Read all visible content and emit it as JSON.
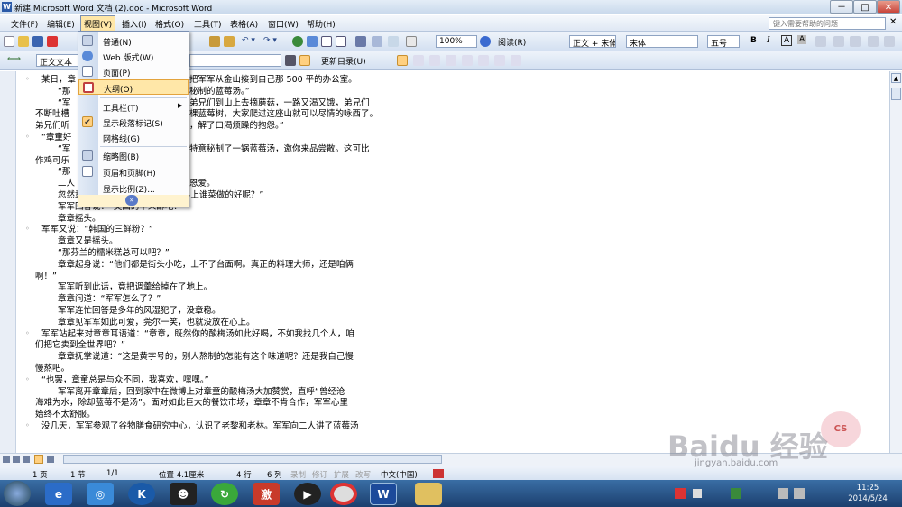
{
  "window": {
    "title": "新建 Microsoft Word 文档 (2).doc - Microsoft Word",
    "controls": [
      "－",
      "□",
      "✕"
    ]
  },
  "menubar": {
    "items": [
      "文件(F)",
      "编辑(E)",
      "视图(V)",
      "插入(I)",
      "格式(O)",
      "工具(T)",
      "表格(A)",
      "窗口(W)",
      "帮助(H)"
    ],
    "help_placeholder": "键入需要帮助的问题"
  },
  "toolbar1": {
    "zoom": "100%",
    "read_mode": "阅读(R)",
    "style": "正文 + 宋体",
    "font": "宋体",
    "size": "五号",
    "bold": "B",
    "italic": "I",
    "charborder": "A",
    "charshade": "A"
  },
  "toolbar2": {
    "style_box": "正文文本",
    "update_toc": "更新目录(U)"
  },
  "view_menu": {
    "items": [
      {
        "label": "普通(N)"
      },
      {
        "label": "Web 版式(W)"
      },
      {
        "label": "页面(P)"
      },
      {
        "label": "大纲(O)",
        "highlighted": true
      },
      {
        "label": "工具栏(T)",
        "submenu": true
      },
      {
        "label": "显示段落标记(S)",
        "checked": true
      },
      {
        "label": "网格线(G)"
      },
      {
        "label": "缩略图(B)"
      },
      {
        "label": "页眉和页脚(H)"
      },
      {
        "label": "显示比例(Z)..."
      }
    ],
    "expand": "»"
  },
  "document": {
    "lines": [
      {
        "text": "某日，章",
        "tail": "把军军从金山接到自己那 500 平的办公室。"
      },
      {
        "text": "“那",
        "tail": "秘制的蓝莓汤。”"
      },
      {
        "text": "“军",
        "tail": "弟兄们到山上去摘蘑菇，一路又渴又饿，弟兄们"
      },
      {
        "text": "不断吐槽",
        "tail": "棵蓝莓树，大家爬过这座山就可以尽情的咏西了。"
      },
      {
        "text": "弟兄们听",
        "tail": "，解了口渴烦躁的抱怨。”"
      },
      {
        "text": "“章童好",
        "tail": ""
      },
      {
        "text": "“军",
        "tail": "特意秘制了一锅蓝莓汤，邀你来品尝散。这可比"
      },
      {
        "text": "作鸡可乐",
        "tail": ""
      },
      {
        "text": "“那",
        "tail": ""
      },
      {
        "text": "二人",
        "tail": "恩爱。"
      },
      {
        "text": "忽然章章开口问军军：“你觉得世界上谁菜做的好呢？”",
        "tail": ""
      },
      {
        "text": "军军回答说：“美国的苹果酥吧？”",
        "tail": ""
      },
      {
        "text": "章章摇头。",
        "tail": ""
      },
      {
        "text": "军军又说：“韩国的三鲜粉？”",
        "tail": ""
      },
      {
        "text": "章章又是摇头。",
        "tail": ""
      },
      {
        "text": "“那芬兰的糯米糕总可以吧？”",
        "tail": ""
      },
      {
        "text": "章章起身说：“他们都是街头小吃，上不了台面啊。真正的料理大师，还是咱俩",
        "tail": ""
      },
      {
        "text": "啊！”",
        "tail": ""
      },
      {
        "text": "军军听到此话，竟把调羹给掉在了地上。",
        "tail": ""
      },
      {
        "text": "章章问道：“军军怎么了？”",
        "tail": ""
      },
      {
        "text": "军军连忙回答是多年的风湿犯了，没章稳。",
        "tail": ""
      },
      {
        "text": "章章见军军如此可爱，莞尔一笑，也就没放在心上。",
        "tail": ""
      },
      {
        "text": "军军站起来对章章耳语道：“章章，既然你的酸梅汤如此好喝，不如我找几个人，咱",
        "tail": ""
      },
      {
        "text": "们把它卖到全世界吧？”",
        "tail": ""
      },
      {
        "text": "章章抚掌说道：“这是黄字号的，别人熬制的怎能有这个味道呢？还是我自己慢",
        "tail": ""
      },
      {
        "text": "慢熬吧。",
        "tail": ""
      },
      {
        "text": "“也罢，章童总是与众不同，我喜欢，嘿嘿。”",
        "tail": ""
      },
      {
        "text": "军军离开章章后，回到家中在微博上对章童的酸梅汤大加赞赏，直呼“曾经沧",
        "tail": ""
      },
      {
        "text": "海难为水，除却蓝莓不是汤”。面对如此巨大的餐饮市场，章章不肯合作，军军心里",
        "tail": ""
      },
      {
        "text": "始终不太舒服。",
        "tail": ""
      },
      {
        "text": "没几天，军军参观了谷物膳食研究中心，认识了老黎和老林。军军向二人讲了蓝莓汤",
        "tail": ""
      }
    ]
  },
  "statusbar": {
    "page": "1 页",
    "section": "1 节",
    "pages": "1/1",
    "position": "位置 4.1厘米",
    "row": "4 行",
    "col": "6 列",
    "rec": "录制",
    "trk": "修订",
    "ext": "扩展",
    "ovr": "改写",
    "lang": "中文(中国)"
  },
  "taskbar": {
    "time": "11:25",
    "date": "2014/5/24",
    "apps": [
      "IE",
      "WiFi",
      "K",
      "QQ",
      "Update",
      "Game",
      "Video",
      "Chrome",
      "Word",
      "Folder"
    ]
  },
  "watermark": {
    "brand": "Baidu 经验",
    "url": "jingyan.baidu.com",
    "badge": "CS"
  },
  "colors": {
    "menu_highlight": "#ffe7a8",
    "menu_border": "#e3a33d",
    "taskbar": "#2b5588",
    "titlebar": "#d4e2f2"
  }
}
